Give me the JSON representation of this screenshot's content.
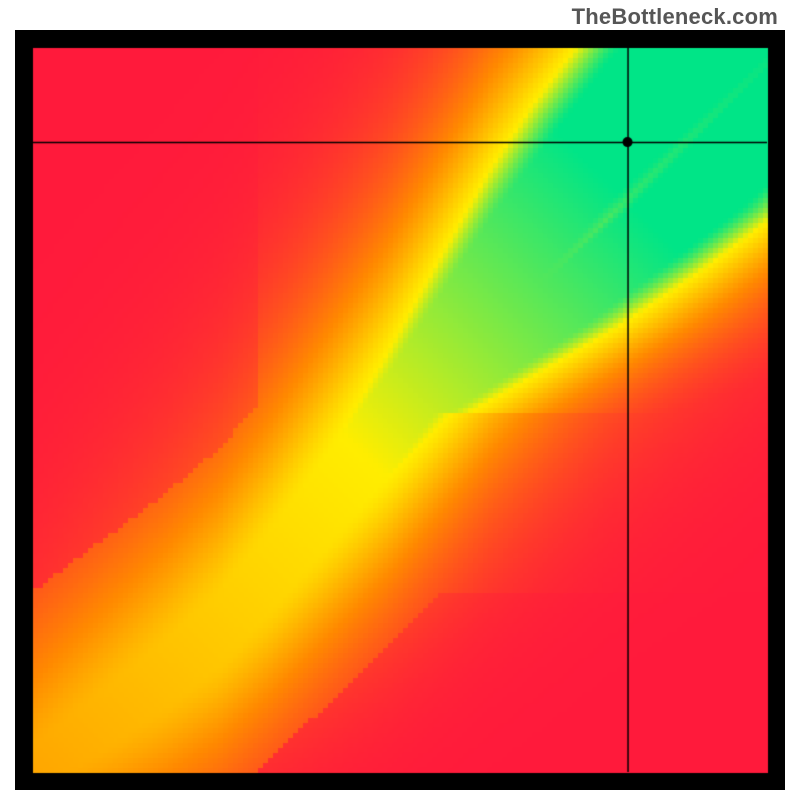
{
  "watermark": "TheBottleneck.com",
  "chart_data": {
    "type": "heatmap",
    "title": "",
    "xlabel": "",
    "ylabel": "",
    "xlim": [
      0,
      1
    ],
    "ylim": [
      0,
      1
    ],
    "marker": {
      "x": 0.81,
      "y": 0.87
    },
    "colors": {
      "low": "#ff1a3c",
      "mid1": "#ff8a00",
      "mid2": "#ffee00",
      "high": "#00e588"
    },
    "green_band": {
      "comment": "approximate centerline of the green optimum band, as (x,y) normalized pairs read off the image; band is the region within ~0.05 of this curve",
      "points": [
        [
          0.02,
          0.02
        ],
        [
          0.1,
          0.08
        ],
        [
          0.18,
          0.14
        ],
        [
          0.25,
          0.2
        ],
        [
          0.32,
          0.28
        ],
        [
          0.4,
          0.38
        ],
        [
          0.48,
          0.48
        ],
        [
          0.55,
          0.58
        ],
        [
          0.62,
          0.68
        ],
        [
          0.7,
          0.78
        ],
        [
          0.78,
          0.88
        ],
        [
          0.86,
          0.96
        ]
      ],
      "half_width": 0.045
    }
  }
}
